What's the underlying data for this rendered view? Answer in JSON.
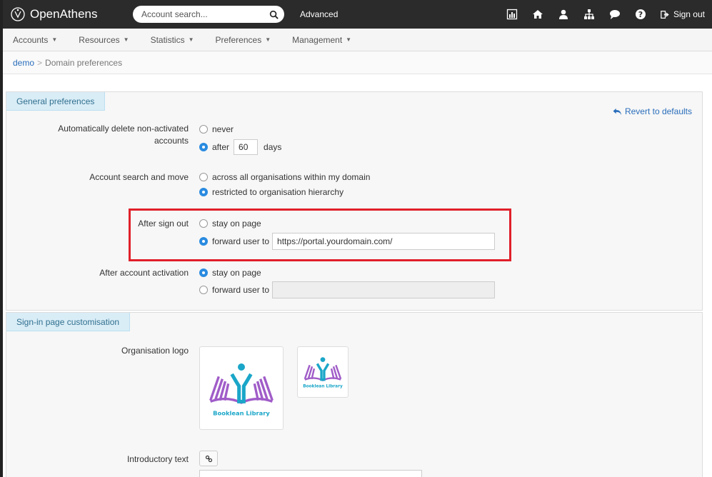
{
  "topbar": {
    "brand": "OpenAthens",
    "search_placeholder": "Account search...",
    "advanced": "Advanced",
    "signout": "Sign out",
    "icons": [
      "stats-icon",
      "home-icon",
      "user-icon",
      "hierarchy-icon",
      "chat-icon",
      "help-icon"
    ]
  },
  "subnav": {
    "items": [
      "Accounts",
      "Resources",
      "Statistics",
      "Preferences",
      "Management"
    ]
  },
  "breadcrumb": {
    "root": "demo",
    "separator": ">",
    "current": "Domain preferences"
  },
  "general": {
    "tab": "General preferences",
    "revert": "Revert to defaults",
    "auto_delete": {
      "label_line1": "Automatically delete non-activated",
      "label_line2": "accounts",
      "opt_never": "never",
      "opt_after": "after",
      "days_value": "60",
      "days_unit": "days"
    },
    "search_move": {
      "label": "Account search and move",
      "opt_all": "across all organisations within my domain",
      "opt_restricted": "restricted to organisation hierarchy"
    },
    "after_signout": {
      "label": "After sign out",
      "opt_stay": "stay on page",
      "opt_forward": "forward user to",
      "url_value": "https://portal.yourdomain.com/"
    },
    "after_activation": {
      "label": "After account activation",
      "opt_stay": "stay on page",
      "opt_forward": "forward user to",
      "url_value": ""
    }
  },
  "signin": {
    "tab": "Sign-in page customisation",
    "logo_label": "Organisation logo",
    "logo_caption": "Booklean Library",
    "intro_label": "Introductory text"
  },
  "colors": {
    "navbar": "#2b2b2b",
    "accent": "#2a8be0",
    "tab_bg": "#d9edf7",
    "highlight": "#e0202a",
    "logo_purple": "#a05cc8",
    "logo_teal": "#1aa6c8"
  }
}
